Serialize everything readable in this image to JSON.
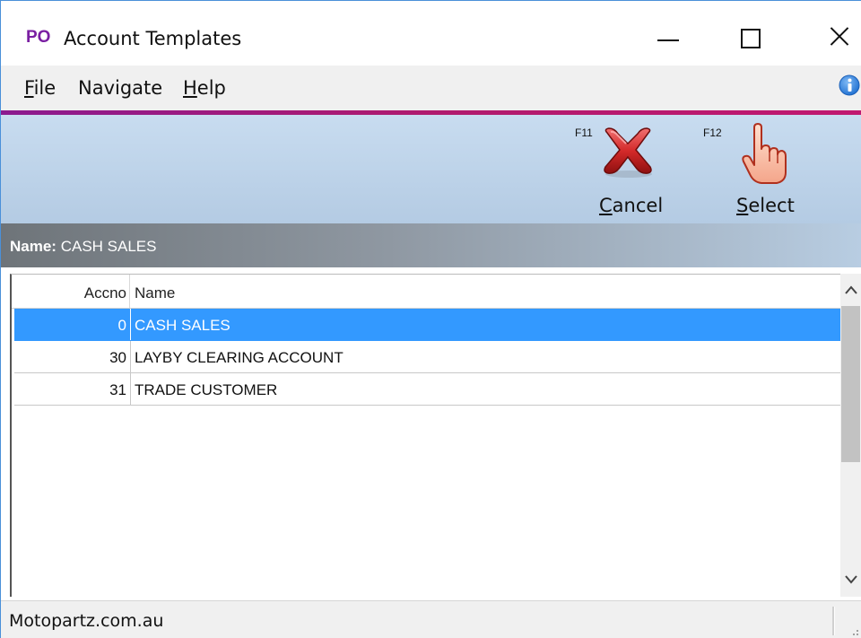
{
  "window": {
    "app_badge": "PO",
    "title": "Account Templates"
  },
  "menu": {
    "file_u": "F",
    "file_rest": "ile",
    "navigate": "Navigate",
    "help_u": "H",
    "help_rest": "elp"
  },
  "toolbar": {
    "cancel": {
      "fkey": "F11",
      "label_u": "C",
      "label_rest": "ancel",
      "icon": "red-x-icon"
    },
    "select": {
      "fkey": "F12",
      "label_u": "S",
      "label_rest": "elect",
      "icon": "pointing-hand-icon"
    }
  },
  "name_banner": {
    "label": "Name:",
    "value": "CASH SALES"
  },
  "grid": {
    "columns": [
      "Accno",
      "Name"
    ],
    "rows": [
      {
        "accno": "0",
        "name": "CASH SALES",
        "selected": true
      },
      {
        "accno": "30",
        "name": "LAYBY CLEARING ACCOUNT",
        "selected": false
      },
      {
        "accno": "31",
        "name": "TRADE CUSTOMER",
        "selected": false
      }
    ]
  },
  "status": {
    "text": "Motopartz.com.au"
  },
  "colors": {
    "accent_gradient_start": "#8b1a8f",
    "selection": "#3399ff",
    "badge": "#7a1fa2"
  }
}
